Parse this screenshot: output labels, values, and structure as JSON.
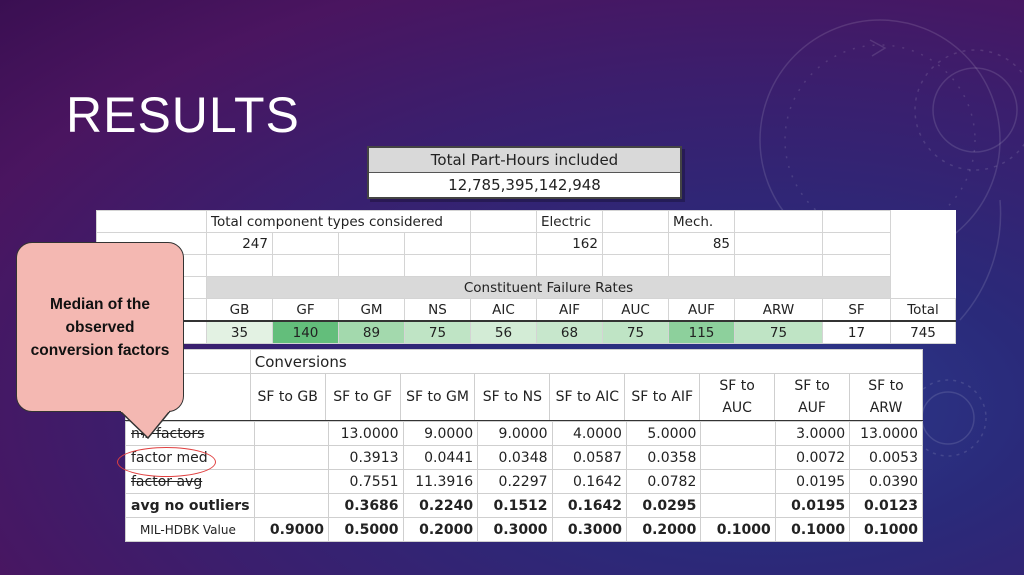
{
  "slide": {
    "title": "RESULTS"
  },
  "part_hours": {
    "header": "Total Part-Hours included",
    "value": "12,785,395,142,948"
  },
  "component_types": {
    "label": "Total component types considered",
    "total": "247",
    "electric_label": "Electric",
    "electric": "162",
    "mech_label": "Mech.",
    "mech": "85"
  },
  "failure_rates": {
    "title": "Constituent Failure Rates",
    "columns": [
      "GB",
      "GF",
      "GM",
      "NS",
      "AIC",
      "AIF",
      "AUC",
      "AUF",
      "ARW",
      "SF",
      "Total"
    ],
    "values": [
      "35",
      "140",
      "89",
      "75",
      "56",
      "68",
      "75",
      "115",
      "75",
      "17",
      "745"
    ],
    "cell_colors": [
      "#e3f2e3",
      "#63be7b",
      "#a3d9ad",
      "#bfe4c5",
      "#d3ecd6",
      "#c7e7cc",
      "#bfe4c5",
      "#8dd09c",
      "#bfe4c5",
      "#ffffff",
      "#ffffff"
    ]
  },
  "conversions": {
    "title": "Conversions",
    "headers": [
      "SF to GB",
      "SF to GF",
      "SF to GM",
      "SF to NS",
      "SF to AIC",
      "SF to AIF",
      "SF to AUC",
      "SF to AUF",
      "SF to ARW"
    ],
    "rows": [
      {
        "label": "n# factors",
        "values": [
          "",
          "13.0000",
          "9.0000",
          "9.0000",
          "4.0000",
          "5.0000",
          "",
          "3.0000",
          "13.0000"
        ]
      },
      {
        "label": "factor med",
        "values": [
          "",
          "0.3913",
          "0.0441",
          "0.0348",
          "0.0587",
          "0.0358",
          "",
          "0.0072",
          "0.0053"
        ]
      },
      {
        "label": "factor avg",
        "values": [
          "",
          "0.7551",
          "11.3916",
          "0.2297",
          "0.1642",
          "0.0782",
          "",
          "0.0195",
          "0.0390"
        ]
      },
      {
        "label": "avg no outliers",
        "values": [
          "",
          "0.3686",
          "0.2240",
          "0.1512",
          "0.1642",
          "0.0295",
          "",
          "0.0195",
          "0.0123"
        ]
      },
      {
        "label": "MIL-HDBK Value",
        "values": [
          "0.9000",
          "0.5000",
          "0.2000",
          "0.3000",
          "0.3000",
          "0.2000",
          "0.1000",
          "0.1000",
          "0.1000"
        ]
      }
    ]
  },
  "callout": {
    "text": "Median of the observed conversion factors",
    "color": "#f4b8b2"
  },
  "colors": {
    "accent_circle": "#e04040"
  }
}
